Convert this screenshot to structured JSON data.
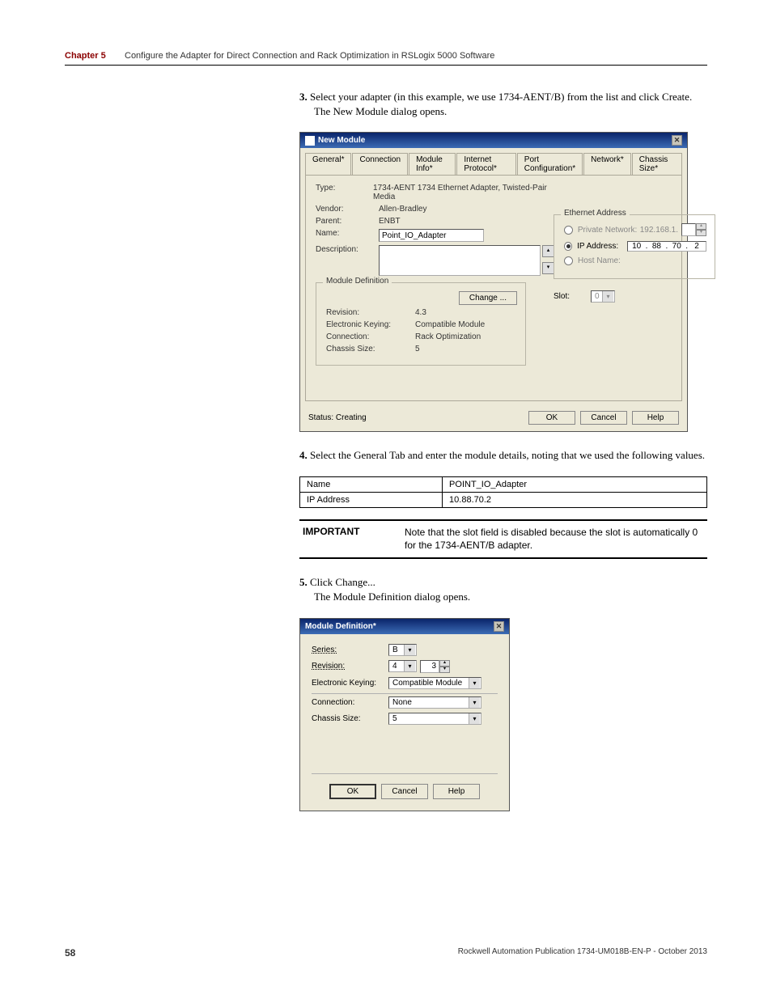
{
  "header": {
    "chapter_label": "Chapter 5",
    "chapter_title": "Configure the Adapter for Direct Connection and Rack Optimization in RSLogix 5000 Software"
  },
  "step3": {
    "num": "3.",
    "line1": "Select your adapter (in this example, we use 1734-AENT/B) from the list and click Create.",
    "line2": "The New Module dialog opens."
  },
  "newmodule": {
    "title": "New Module",
    "close": "✕",
    "tabs": [
      "General*",
      "Connection",
      "Module Info*",
      "Internet Protocol*",
      "Port Configuration*",
      "Network*",
      "Chassis Size*"
    ],
    "type_label": "Type:",
    "type_value": "1734-AENT 1734 Ethernet Adapter, Twisted-Pair Media",
    "vendor_label": "Vendor:",
    "vendor_value": "Allen-Bradley",
    "parent_label": "Parent:",
    "parent_value": "ENBT",
    "name_label": "Name:",
    "name_value": "Point_IO_Adapter",
    "desc_label": "Description:",
    "moddef_title": "Module Definition",
    "change_btn": "Change ...",
    "rev_label": "Revision:",
    "rev_value": "4.3",
    "ek_label": "Electronic Keying:",
    "ek_value": "Compatible Module",
    "conn_label": "Connection:",
    "conn_value": "Rack Optimization",
    "cs_label": "Chassis Size:",
    "cs_value": "5",
    "eth_title": "Ethernet Address",
    "priv_label": "Private Network:",
    "priv_prefix": "192.168.1.",
    "ip_label": "IP Address:",
    "ip": [
      "10",
      "88",
      "70",
      "2"
    ],
    "host_label": "Host Name:",
    "slot_label": "Slot:",
    "slot_value": "0",
    "status_label": "Status: Creating",
    "ok": "OK",
    "cancel": "Cancel",
    "help": "Help"
  },
  "step4": {
    "num": "4.",
    "text": "Select the General Tab and enter the module details, noting that we used the following values."
  },
  "table": {
    "name_label": "Name",
    "name_value": "POINT_IO_Adapter",
    "ip_label": "IP Address",
    "ip_value": "10.88.70.2"
  },
  "important": {
    "label": "IMPORTANT",
    "text": "Note that the slot field is disabled because the slot is automatically 0 for the 1734-AENT/B adapter."
  },
  "step5": {
    "num": "5.",
    "line1": "Click Change...",
    "line2": "The Module Definition dialog opens."
  },
  "moddef": {
    "title": "Module Definition*",
    "close": "✕",
    "series_label": "Series:",
    "series_value": "B",
    "rev_label": "Revision:",
    "rev_value": "4",
    "rev_minor": "3",
    "ek_label": "Electronic Keying:",
    "ek_value": "Compatible Module",
    "conn_label": "Connection:",
    "conn_value": "None",
    "cs_label": "Chassis Size:",
    "cs_value": "5",
    "ok": "OK",
    "cancel": "Cancel",
    "help": "Help"
  },
  "footer": {
    "page": "58",
    "pub": "Rockwell Automation Publication 1734-UM018B-EN-P - October 2013"
  }
}
